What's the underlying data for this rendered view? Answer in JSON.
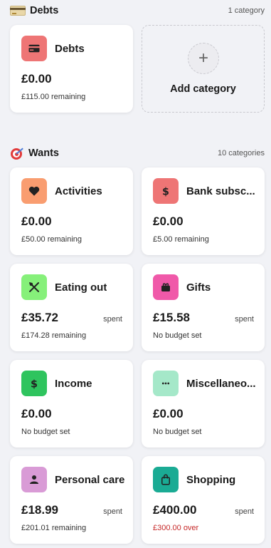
{
  "colors": {
    "debts_icon": "#ee7575",
    "activities_icon": "#f99d70",
    "bank_icon": "#ee7575",
    "eating_out_icon": "#86f07a",
    "gifts_icon": "#f059a9",
    "income_icon": "#2fc45e",
    "misc_icon": "#a5e8c9",
    "personal_care_icon": "#d99bd6",
    "shopping_icon": "#1aab94",
    "over_budget": "#c62828"
  },
  "debts": {
    "title": "Debts",
    "count": "1 category",
    "icon": "credit-card-emoji",
    "cards": [
      {
        "name": "Debts",
        "amount": "£0.00",
        "sub": "£115.00 remaining",
        "icon": "credit-card-icon"
      }
    ],
    "add_label": "Add category"
  },
  "wants": {
    "title": "Wants",
    "count": "10 categories",
    "icon": "dart-emoji",
    "cards": [
      {
        "name": "Activities",
        "amount": "£0.00",
        "sub": "£50.00 remaining",
        "icon": "heart-icon"
      },
      {
        "name": "Bank subsc...",
        "amount": "£0.00",
        "sub": "£5.00 remaining",
        "icon": "dollar-icon"
      },
      {
        "name": "Eating out",
        "amount": "£35.72",
        "spent": "spent",
        "sub": "£174.28 remaining",
        "icon": "cutlery-icon"
      },
      {
        "name": "Gifts",
        "amount": "£15.58",
        "spent": "spent",
        "sub": "No budget set",
        "icon": "gift-icon"
      },
      {
        "name": "Income",
        "amount": "£0.00",
        "sub": "No budget set",
        "icon": "dollar-icon"
      },
      {
        "name": "Miscellaneo...",
        "amount": "£0.00",
        "sub": "No budget set",
        "icon": "ellipsis-icon"
      },
      {
        "name": "Personal care",
        "amount": "£18.99",
        "spent": "spent",
        "sub": "£201.01 remaining",
        "icon": "person-icon"
      },
      {
        "name": "Shopping",
        "amount": "£400.00",
        "spent": "spent",
        "sub": "£300.00 over",
        "icon": "shopping-bag-icon"
      }
    ]
  }
}
